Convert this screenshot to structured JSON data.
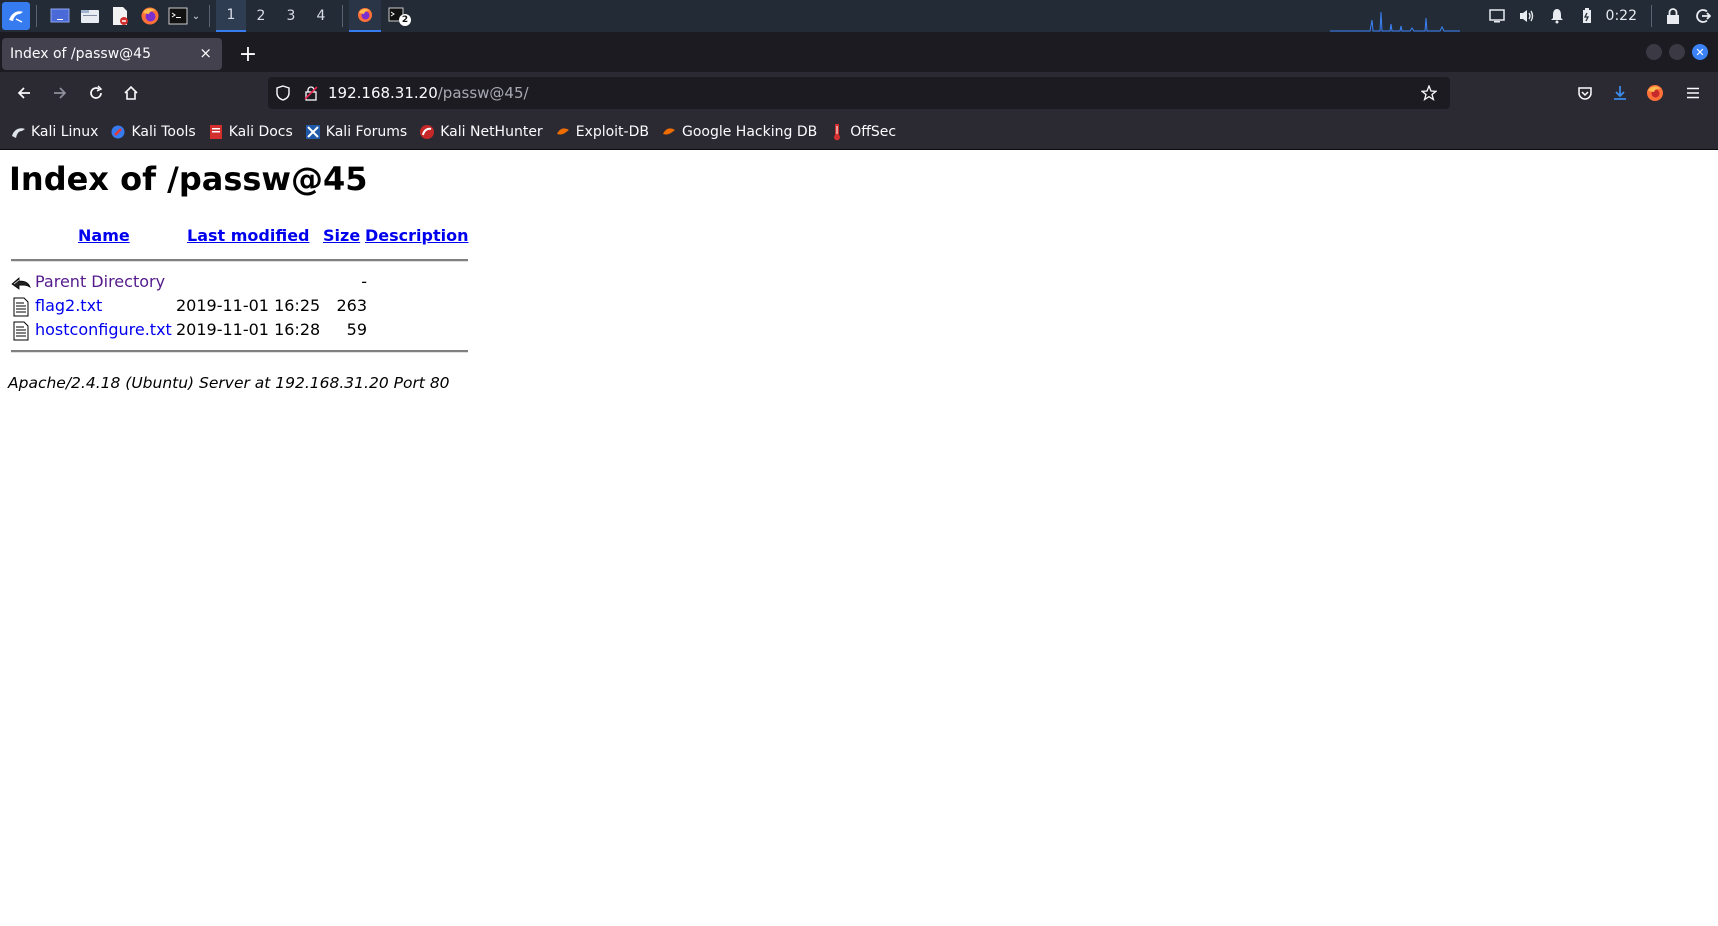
{
  "panel": {
    "workspaces": [
      "1",
      "2",
      "3",
      "4"
    ],
    "active_workspace": "1",
    "clock": "0:22",
    "terminal_badge": "2"
  },
  "browser": {
    "tab_title": "Index of /passw@45",
    "close_tab": "×",
    "new_tab": "+",
    "url_host": "192.168.31.20",
    "url_path": "/passw@45/"
  },
  "bookmarks": [
    {
      "label": "Kali Linux",
      "icon": "kali-dragon-icon"
    },
    {
      "label": "Kali Tools",
      "icon": "kali-tools-icon"
    },
    {
      "label": "Kali Docs",
      "icon": "kali-docs-icon"
    },
    {
      "label": "Kali Forums",
      "icon": "kali-forums-icon"
    },
    {
      "label": "Kali NetHunter",
      "icon": "nethunter-icon"
    },
    {
      "label": "Exploit-DB",
      "icon": "exploit-db-icon"
    },
    {
      "label": "Google Hacking DB",
      "icon": "ghdb-icon"
    },
    {
      "label": "OffSec",
      "icon": "offsec-icon"
    }
  ],
  "page": {
    "title": "Index of /passw@45",
    "columns": {
      "name": "Name",
      "last_modified": "Last modified",
      "size": "Size",
      "description": "Description"
    },
    "entries": [
      {
        "name": "Parent Directory",
        "modified": "",
        "size": "-",
        "icon": "back-arrow-icon"
      },
      {
        "name": "flag2.txt",
        "modified": "2019-11-01 16:25",
        "size": "263",
        "icon": "text-file-icon"
      },
      {
        "name": "hostconfigure.txt",
        "modified": "2019-11-01 16:28",
        "size": "59",
        "icon": "text-file-icon"
      }
    ],
    "address": "Apache/2.4.18 (Ubuntu) Server at 192.168.31.20 Port 80"
  },
  "colors": {
    "panel_bg": "#232b36",
    "kali_blue": "#367bf0",
    "tab_bg": "#42414d",
    "toolbar_bg": "#2b2a33",
    "link": "#0000ee",
    "visited_link": "#551a8b"
  }
}
